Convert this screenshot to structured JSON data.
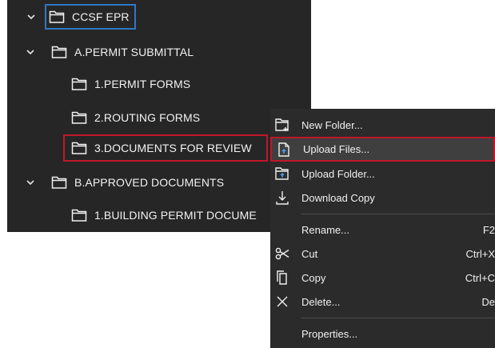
{
  "tree": {
    "items": [
      {
        "label": "CCSF EPR",
        "level": 0,
        "expanded": true
      },
      {
        "label": "A.PERMIT SUBMITTAL",
        "level": 1,
        "expanded": true
      },
      {
        "label": "1.PERMIT FORMS",
        "level": 2
      },
      {
        "label": "2.ROUTING FORMS",
        "level": 2
      },
      {
        "label": "3.DOCUMENTS FOR REVIEW",
        "level": 2,
        "selected": true
      },
      {
        "label": "B.APPROVED DOCUMENTS",
        "level": 1,
        "expanded": true
      },
      {
        "label": "1.BUILDING PERMIT DOCUME",
        "level": 2
      }
    ]
  },
  "context_menu": {
    "items": [
      {
        "label": "New Folder...",
        "icon": "new-folder-icon"
      },
      {
        "label": "Upload Files...",
        "icon": "upload-file-icon",
        "highlighted": true
      },
      {
        "label": "Upload Folder...",
        "icon": "upload-folder-icon"
      },
      {
        "label": "Download Copy",
        "icon": "download-icon"
      },
      {
        "label": "Rename...",
        "shortcut": "F2"
      },
      {
        "label": "Cut",
        "shortcut": "Ctrl+X",
        "icon": "scissors-icon"
      },
      {
        "label": "Copy",
        "shortcut": "Ctrl+C",
        "icon": "copy-icon"
      },
      {
        "label": "Delete...",
        "shortcut": "De",
        "icon": "delete-x-icon"
      },
      {
        "label": "Properties..."
      }
    ]
  },
  "colors": {
    "panel_bg": "#262626",
    "menu_bg": "#2b2b2b",
    "selection_frame": "#c0182a",
    "focus_frame": "#2f78c4"
  }
}
